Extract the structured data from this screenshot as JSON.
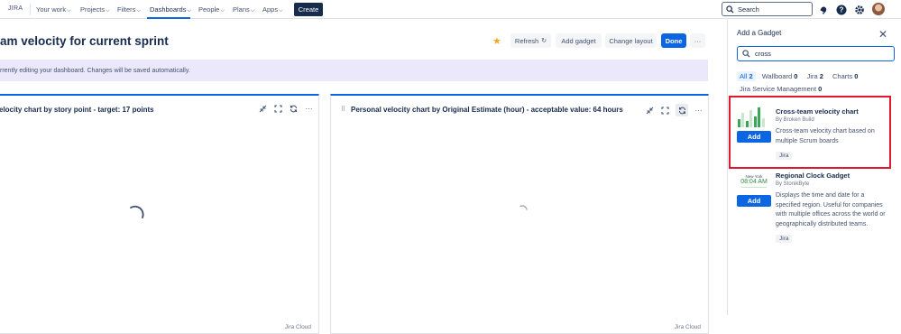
{
  "topbar": {
    "logo": "JIRA",
    "nav": [
      {
        "label": "Your work"
      },
      {
        "label": "Projects"
      },
      {
        "label": "Filters"
      },
      {
        "label": "Dashboards"
      },
      {
        "label": "People"
      },
      {
        "label": "Plans"
      },
      {
        "label": "Apps"
      }
    ],
    "create_label": "Create",
    "search_placeholder": "Search"
  },
  "header": {
    "title": "am velocity for current sprint",
    "buttons": {
      "refresh": "Refresh",
      "add_gadget": "Add gadget",
      "change_layout": "Change layout",
      "done": "Done",
      "more": "···"
    }
  },
  "banner": {
    "text": "rrently editing your dashboard. Changes will be saved automatically."
  },
  "gadgets": [
    {
      "title": "elocity chart by story point - target: 17 points",
      "source": "Jira Cloud"
    },
    {
      "title": "Personal velocity chart by Original Estimate (hour) - acceptable value: 64 hours",
      "source": "Jira Cloud"
    }
  ],
  "panel": {
    "title": "Add a Gadget",
    "search_value": "cross",
    "filters": [
      {
        "label": "All",
        "count": "2",
        "selected": true
      },
      {
        "label": "Wallboard",
        "count": "0"
      },
      {
        "label": "Jira",
        "count": "2"
      },
      {
        "label": "Charts",
        "count": "0"
      },
      {
        "label": "Jira Service Management",
        "count": "0"
      }
    ],
    "results": [
      {
        "name": "Cross-team velocity chart",
        "by": "By Broken Build",
        "description": "Cross-team velocity chart based on multiple Scrum boards",
        "add": "Add",
        "tag": "Jira"
      },
      {
        "name": "Regional Clock Gadget",
        "by": "By StonikByte",
        "description": "Displays the time and date for a specified region. Useful for companies with multiple offices across the world or geographically distributed teams.",
        "add": "Add",
        "tag": "Jira",
        "thumb_city": "New York",
        "thumb_time": "08:04 AM"
      }
    ]
  },
  "colors": {
    "accent": "#0c66e4",
    "highlight": "#e0182d",
    "banner": "#ece8fb"
  }
}
